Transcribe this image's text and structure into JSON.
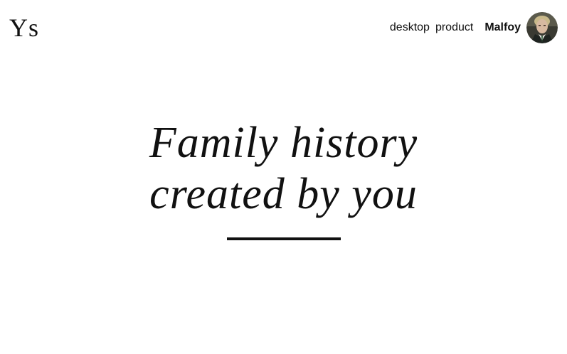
{
  "header": {
    "logo_text": "Ys",
    "nav": [
      {
        "label": "desktop"
      },
      {
        "label": "product"
      }
    ],
    "user": {
      "name": "Malfoy",
      "avatar_icon": "user-avatar-photo"
    }
  },
  "hero": {
    "line1": "Family history",
    "line2": "created by you"
  },
  "colors": {
    "background": "#ffffff",
    "text": "#111111",
    "divider": "#111111"
  }
}
